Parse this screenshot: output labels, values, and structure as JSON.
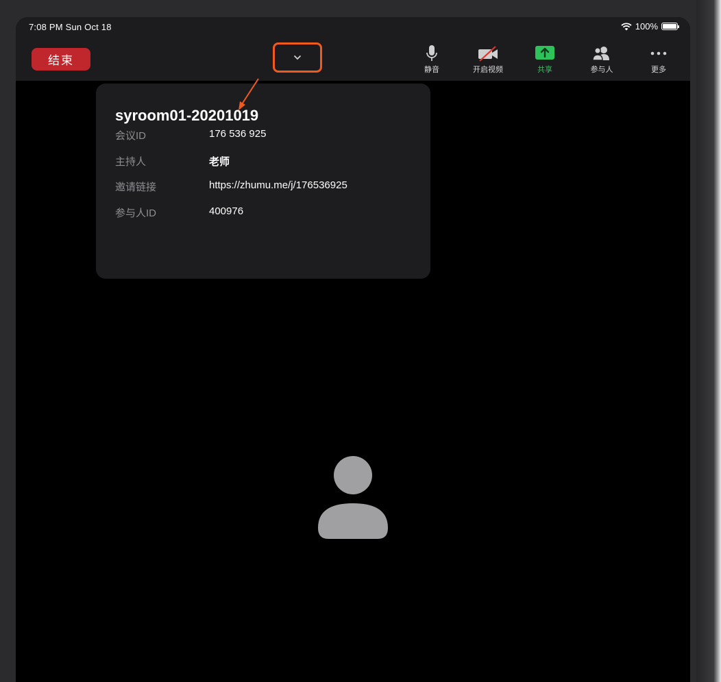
{
  "status_bar": {
    "time": "7:08 PM   Sun Oct 18",
    "battery": "100%",
    "battery_level": 1.0
  },
  "toolbar": {
    "end_label": "结束",
    "collapse_icon": "chevron-down-icon",
    "tools": [
      {
        "icon": "microphone-icon",
        "label": "静音"
      },
      {
        "icon": "video-off-icon",
        "label": "开启视频"
      },
      {
        "icon": "share-screen-icon",
        "label": "共享"
      },
      {
        "icon": "participants-icon",
        "label": "参与人"
      },
      {
        "icon": "more-icon",
        "label": "更多"
      }
    ]
  },
  "meeting_info": {
    "title": "syroom01-20201019",
    "rows": [
      {
        "label": "会议ID",
        "value": "176 536 925"
      },
      {
        "label": "主持人",
        "value": "老师"
      },
      {
        "label": "邀请链接",
        "value": "https://zhumu.me/j/176536925"
      },
      {
        "label": "参与人ID",
        "value": "400976"
      }
    ]
  },
  "colors": {
    "end_button": "#c0272d",
    "highlight": "#f05a1e",
    "share_green": "#2ec25a",
    "panel_bg": "#1d1d1f",
    "avatar": "#a0a0a3"
  }
}
